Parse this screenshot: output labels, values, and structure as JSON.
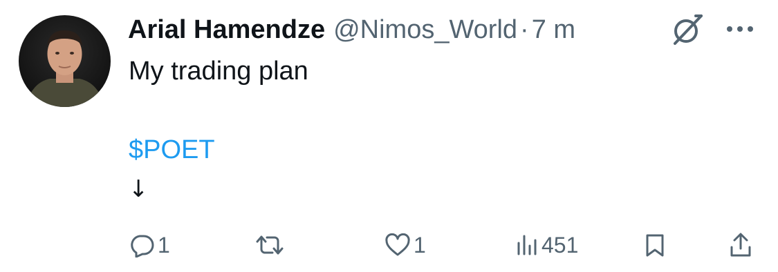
{
  "tweet": {
    "author_name": "Arial Hamendze",
    "handle": "@Nimos_World",
    "separator": "·",
    "time": "7 m",
    "text_line1": "My trading plan",
    "cashtag": "$POET",
    "arrow": "↓"
  },
  "actions": {
    "reply_count": "1",
    "like_count": "1",
    "view_count": "451"
  },
  "icons": {
    "avatar": "avatar",
    "grok": "grok-icon",
    "more": "more-icon",
    "reply": "reply-icon",
    "retweet": "retweet-icon",
    "like": "like-icon",
    "views": "views-icon",
    "bookmark": "bookmark-icon",
    "share": "share-icon"
  },
  "colors": {
    "text": "#0f1419",
    "secondary": "#536471",
    "link": "#1d9bf0"
  }
}
